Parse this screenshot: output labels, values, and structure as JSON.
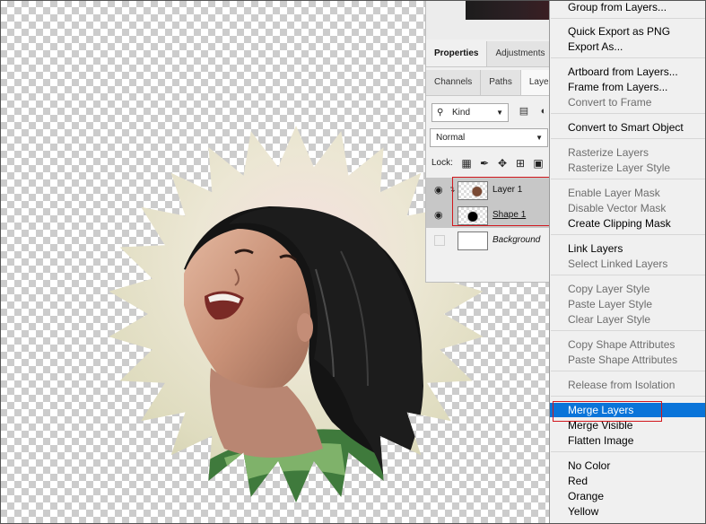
{
  "panel": {
    "tabs_row1": [
      "Properties",
      "Adjustments"
    ],
    "tabs_row2": [
      "Channels",
      "Paths",
      "Layers"
    ],
    "kind_filter": "Kind",
    "blend_mode": "Normal",
    "lock_label": "Lock:",
    "layers": [
      {
        "name": "Layer 1",
        "visible": true,
        "selected": true,
        "clipped": true
      },
      {
        "name": "Shape 1",
        "visible": true,
        "selected": true,
        "clipped": false
      },
      {
        "name": "Background",
        "visible": false,
        "selected": false,
        "clipped": false
      }
    ]
  },
  "menu": {
    "items": [
      {
        "label": "Group from Layers...",
        "disabled": false
      },
      {
        "label": "Quick Export as PNG",
        "disabled": false
      },
      {
        "label": "Export As...",
        "disabled": false
      },
      {
        "label": "Artboard from Layers...",
        "disabled": false
      },
      {
        "label": "Frame from Layers...",
        "disabled": false
      },
      {
        "label": "Convert to Frame",
        "disabled": true
      },
      {
        "label": "Convert to Smart Object",
        "disabled": false
      },
      {
        "label": "Rasterize Layers",
        "disabled": true
      },
      {
        "label": "Rasterize Layer Style",
        "disabled": true
      },
      {
        "label": "Enable Layer Mask",
        "disabled": true
      },
      {
        "label": "Disable Vector Mask",
        "disabled": true
      },
      {
        "label": "Create Clipping Mask",
        "disabled": false
      },
      {
        "label": "Link Layers",
        "disabled": false
      },
      {
        "label": "Select Linked Layers",
        "disabled": true
      },
      {
        "label": "Copy Layer Style",
        "disabled": true
      },
      {
        "label": "Paste Layer Style",
        "disabled": true
      },
      {
        "label": "Clear Layer Style",
        "disabled": true
      },
      {
        "label": "Copy Shape Attributes",
        "disabled": true
      },
      {
        "label": "Paste Shape Attributes",
        "disabled": true
      },
      {
        "label": "Release from Isolation",
        "disabled": true
      },
      {
        "label": "Merge Layers",
        "disabled": false,
        "highlighted": true
      },
      {
        "label": "Merge Visible",
        "disabled": false
      },
      {
        "label": "Flatten Image",
        "disabled": false
      },
      {
        "label": "No Color",
        "disabled": false
      },
      {
        "label": "Red",
        "disabled": false
      },
      {
        "label": "Orange",
        "disabled": false
      },
      {
        "label": "Yellow",
        "disabled": false
      }
    ]
  },
  "colors": {
    "menu_highlight": "#0a74d9",
    "annotation_box": "#d2171d",
    "layer_selected": "#c7c7c7"
  }
}
